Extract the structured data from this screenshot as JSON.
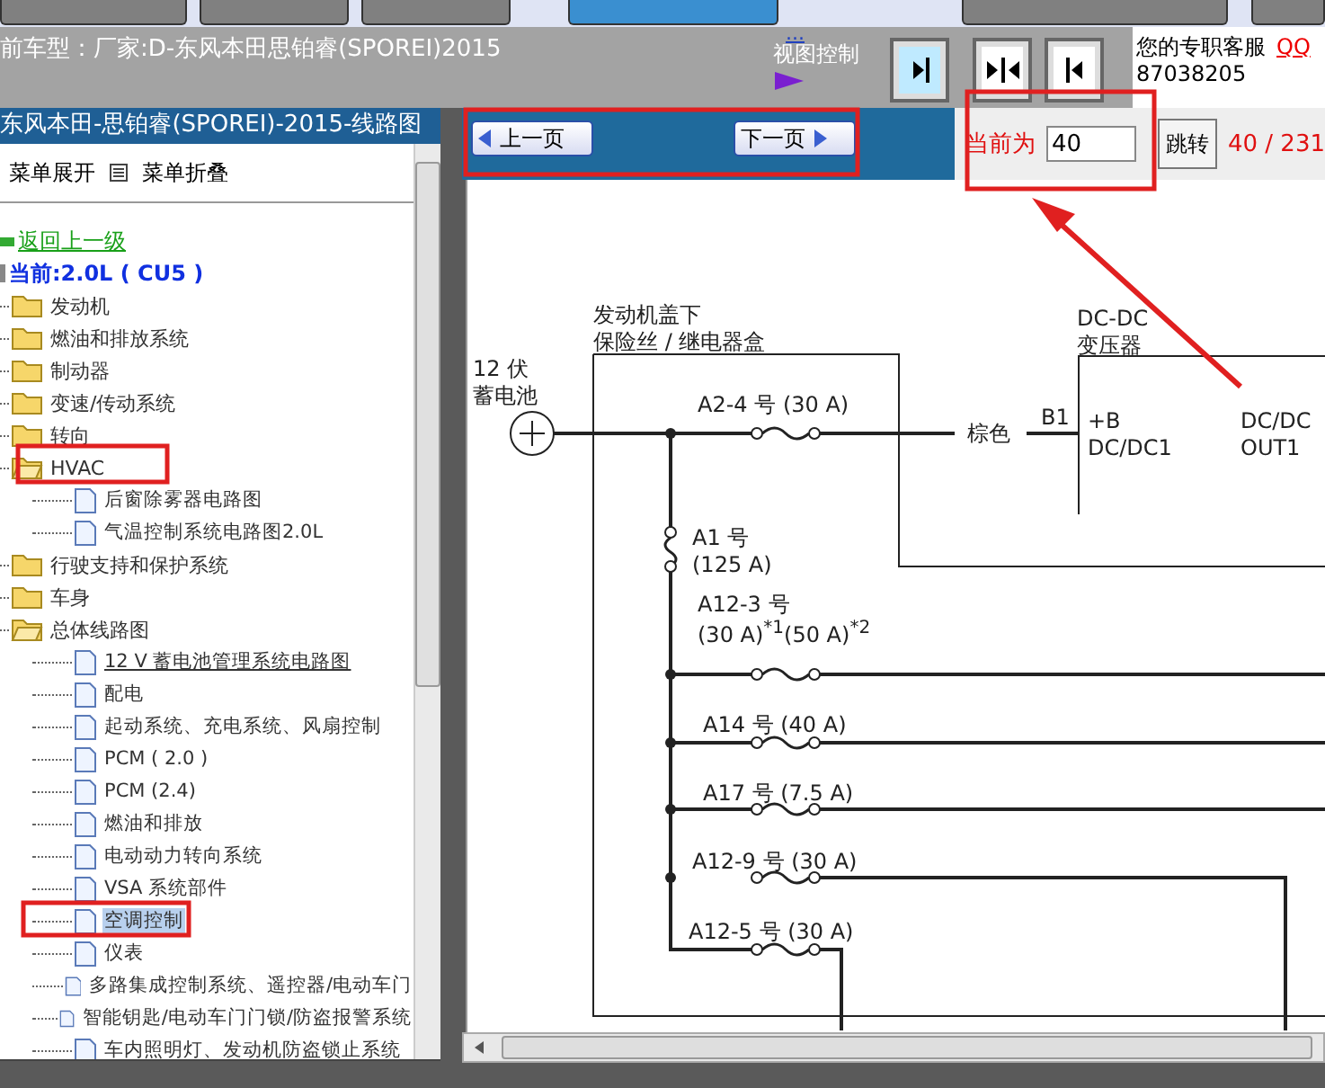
{
  "header": {
    "model": "前车型：厂家:D-东风本田思铂睿(SPOREI)2015",
    "link": "...",
    "view_control": "视图控制",
    "service": "您的专职客服",
    "qq": "QQ",
    "phone": "87038205"
  },
  "sidebar": {
    "title": "东风本田-思铂睿(SPOREI)-2015-线路图",
    "expand": "菜单展开",
    "collapse": "菜单折叠",
    "back": "返回上一级",
    "current": "当前:2.0L ( CU5 )",
    "items": [
      {
        "kind": "folder",
        "label": "发动机",
        "expanded": false,
        "selected": false
      },
      {
        "kind": "folder",
        "label": "燃油和排放系统",
        "expanded": false,
        "selected": false
      },
      {
        "kind": "folder",
        "label": "制动器",
        "expanded": false,
        "selected": false
      },
      {
        "kind": "folder",
        "label": "变速/传动系统",
        "expanded": false,
        "selected": false
      },
      {
        "kind": "folder",
        "label": "转向",
        "expanded": false,
        "selected": false
      },
      {
        "kind": "folder",
        "label": "HVAC",
        "expanded": true,
        "selected": false,
        "children": [
          {
            "kind": "page",
            "label": "后窗除雾器电路图",
            "selected": false
          },
          {
            "kind": "page",
            "label": "气温控制系统电路图2.0L",
            "selected": false
          }
        ]
      },
      {
        "kind": "folder",
        "label": "行驶支持和保护系统",
        "expanded": false,
        "selected": false
      },
      {
        "kind": "folder",
        "label": "车身",
        "expanded": false,
        "selected": false
      },
      {
        "kind": "folder",
        "label": "总体线路图",
        "expanded": true,
        "selected": false,
        "children": [
          {
            "kind": "page",
            "label": "12 V 蓄电池管理系统电路图",
            "selected": false,
            "hovered": true
          },
          {
            "kind": "page",
            "label": "配电",
            "selected": false
          },
          {
            "kind": "page",
            "label": "起动系统、充电系统、风扇控制",
            "selected": false
          },
          {
            "kind": "page",
            "label": "PCM ( 2.0 )",
            "selected": false
          },
          {
            "kind": "page",
            "label": "PCM (2.4)",
            "selected": false
          },
          {
            "kind": "page",
            "label": "燃油和排放",
            "selected": false
          },
          {
            "kind": "page",
            "label": "电动动力转向系统",
            "selected": false
          },
          {
            "kind": "page",
            "label": "VSA 系统部件",
            "selected": false
          },
          {
            "kind": "page",
            "label": "空调控制",
            "selected": true
          },
          {
            "kind": "page",
            "label": "仪表",
            "selected": false
          },
          {
            "kind": "page",
            "label": "多路集成控制系统、遥控器/电动车门",
            "selected": false
          },
          {
            "kind": "page",
            "label": "智能钥匙/电动车门门锁/防盗报警系统",
            "selected": false
          },
          {
            "kind": "page",
            "label": "车内照明灯、发动机防盗锁止系统",
            "selected": false
          }
        ]
      }
    ]
  },
  "pager": {
    "prev": "上一页",
    "next": "下一页",
    "current_label": "当前为",
    "page": "40",
    "go": "跳转",
    "count": "40 / 231"
  },
  "diagram": {
    "battery": [
      "12 伏",
      "蓄电池"
    ],
    "box_title": [
      "发动机盖下",
      "保险丝 / 继电器盒"
    ],
    "wire_color": "棕色",
    "connector": "B1",
    "converter_title": [
      "DC-DC",
      "变压器"
    ],
    "pin_left": [
      "+B",
      "DC/DC1"
    ],
    "pin_right": [
      "DC/DC",
      "OUT1"
    ],
    "main_fuse": "A2-4 号 (30 A)",
    "bus_fuse": [
      "A1 号",
      "(125 A)"
    ],
    "branches": [
      {
        "label": [
          "A12-3 号",
          "(30 A)$^{*1}$(50 A)$^{*2}$"
        ]
      },
      {
        "label": [
          "A14 号 (40 A)"
        ]
      },
      {
        "label": [
          "A17 号 (7.5 A)"
        ]
      },
      {
        "label": [
          "A12-9 号 (30 A)"
        ]
      },
      {
        "label": [
          "A12-5 号 (30 A)"
        ]
      }
    ]
  }
}
